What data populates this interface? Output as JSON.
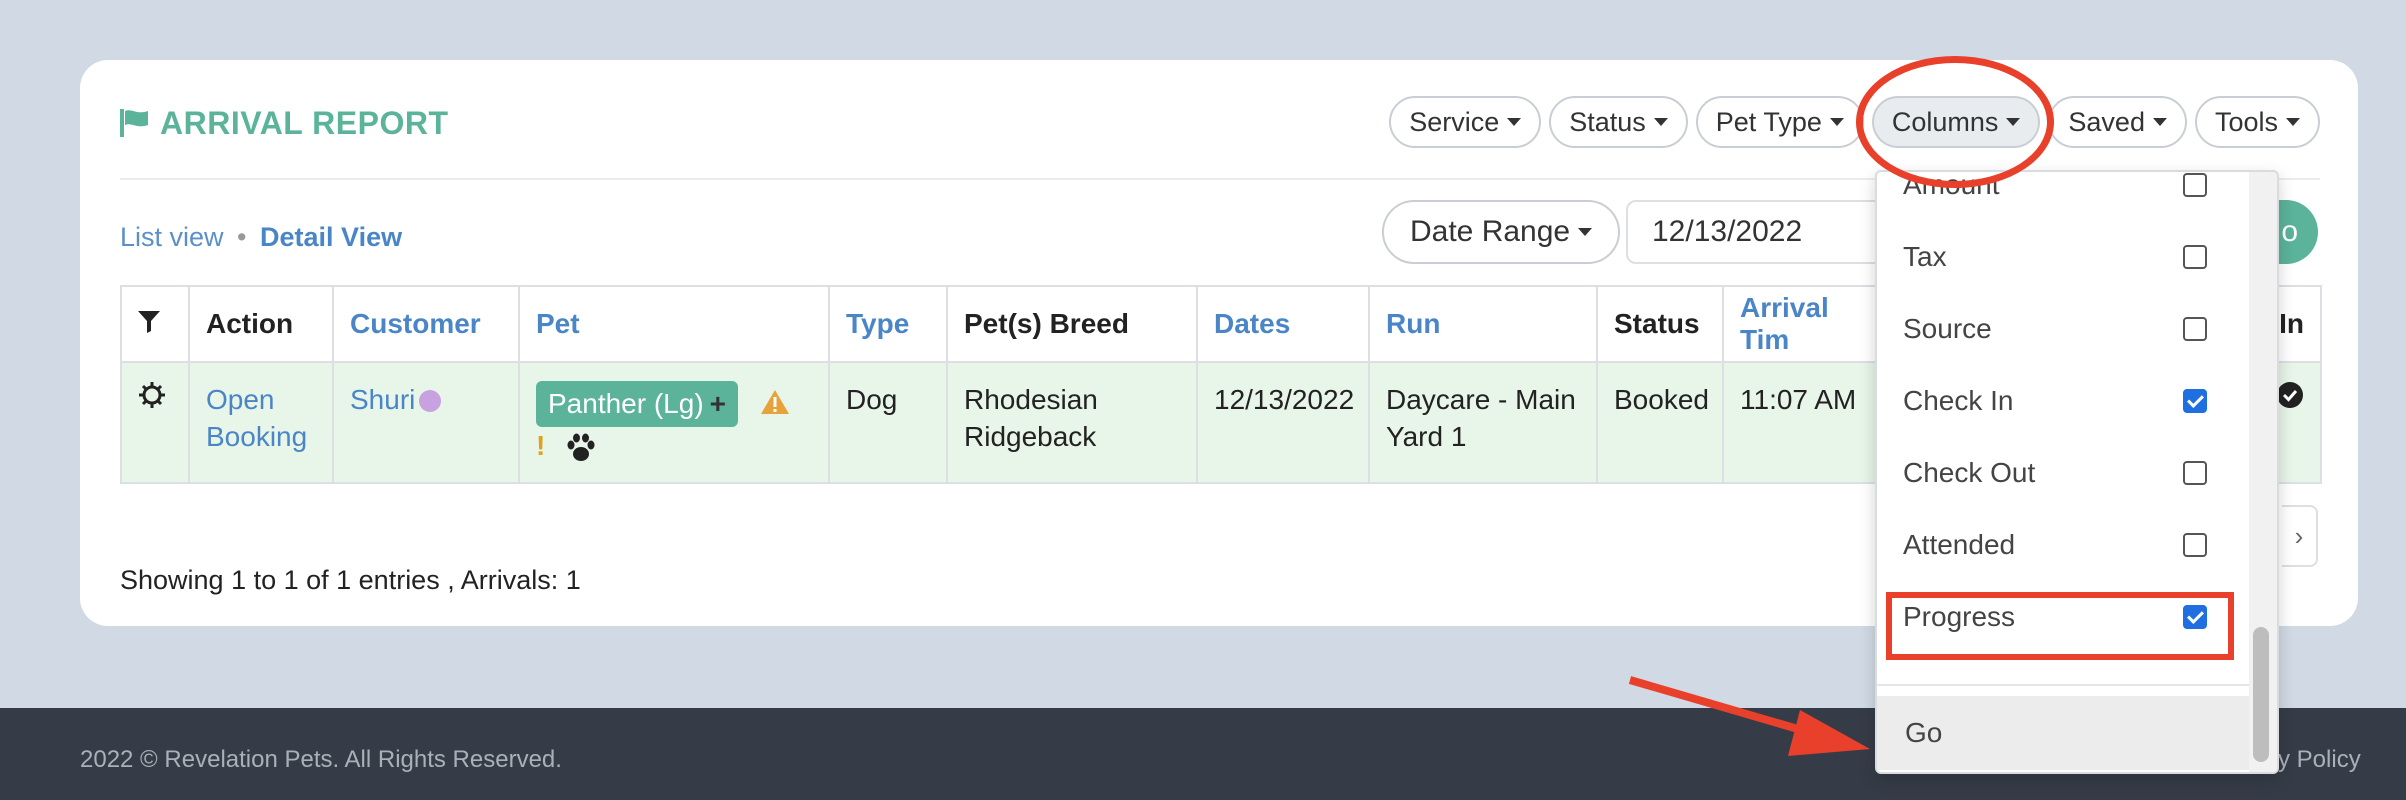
{
  "report": {
    "title": "ARRIVAL REPORT",
    "filters": [
      "Service",
      "Status",
      "Pet Type",
      "Columns",
      "Saved",
      "Tools"
    ],
    "views": {
      "list": "List view",
      "separator": "•",
      "detail": "Detail View"
    },
    "date_range_label": "Date Range",
    "date_value": "12/13/2022",
    "go_label": "o"
  },
  "table": {
    "headers": [
      "Action",
      "Customer",
      "Pet",
      "Type",
      "Pet(s) Breed",
      "Dates",
      "Run",
      "Status",
      "Arrival Tim",
      "In"
    ],
    "row": {
      "action": "Open Booking",
      "customer": "Shuri",
      "pet": "Panther (Lg)",
      "type": "Dog",
      "breed": "Rhodesian Ridgeback",
      "dates": "12/13/2022",
      "run": "Daycare - Main Yard 1",
      "status": "Booked",
      "arrival": "11:07 AM"
    }
  },
  "summary": "Showing 1 to 1 of 1 entries , Arrivals: 1",
  "pager_next": "›",
  "columns_menu": {
    "items": [
      {
        "label": "Amount",
        "checked": false
      },
      {
        "label": "Tax",
        "checked": false
      },
      {
        "label": "Source",
        "checked": false
      },
      {
        "label": "Check In",
        "checked": true
      },
      {
        "label": "Check Out",
        "checked": false
      },
      {
        "label": "Attended",
        "checked": false
      },
      {
        "label": "Progress",
        "checked": true
      }
    ],
    "go": "Go"
  },
  "footer": {
    "copyright": "2022 © Revelation Pets. All Rights Reserved.",
    "policy": "cy Policy"
  },
  "colors": {
    "accent": "#5bb39a",
    "link": "#4a86c7",
    "highlight": "#e8402a",
    "footer": "#363c47"
  },
  "icons": [
    "flag-icon",
    "caret-down-icon",
    "filter-icon",
    "gear-icon",
    "plus-icon",
    "warning-icon",
    "exclamation-icon",
    "paw-icon",
    "check-circle-icon",
    "chevron-right-icon",
    "arrow-annotation"
  ]
}
